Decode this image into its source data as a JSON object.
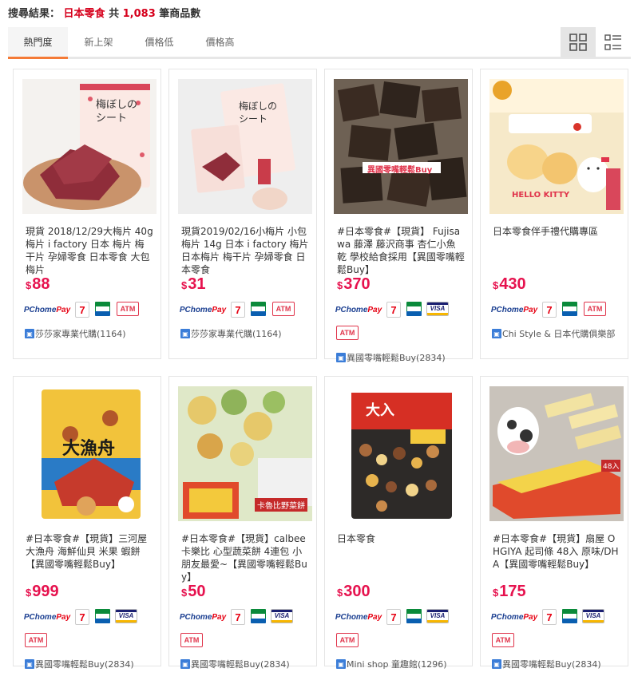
{
  "search": {
    "prefix": "搜尋結果：",
    "keyword": "日本零食",
    "total_prefix": "共",
    "count": "1,083",
    "suffix": "筆商品數"
  },
  "sort_tabs": [
    "熱門度",
    "新上架",
    "價格低",
    "價格高"
  ],
  "active_tab": "熱門度",
  "view_modes": [
    "grid-view-icon",
    "list-view-icon"
  ],
  "colors": {
    "accent": "#f47a36",
    "price": "#e6124e",
    "keyword": "#d6001c"
  },
  "payment_labels": {
    "pchome_pc": "PChome",
    "pchome_pay": "Pay",
    "seven": "7",
    "visa": "VISA",
    "atm": "ATM"
  },
  "products": [
    {
      "title": "現貨 2018/12/29大梅片 40g 梅片 i factory 日本 梅片 梅干片 孕婦零食 日本零食 大包梅片",
      "currency": "$",
      "price": "88",
      "payments": [
        "pchome",
        "seven",
        "family",
        "atm"
      ],
      "seller": "莎莎家專業代購(1164)",
      "image_text": "梅ぼしのシート"
    },
    {
      "title": "現貨2019/02/16小梅片 小包梅片 14g 日本 i factory 梅片 日本梅片 梅干片 孕婦零食 日本零食",
      "currency": "$",
      "price": "31",
      "payments": [
        "pchome",
        "seven",
        "family",
        "atm"
      ],
      "seller": "莎莎家專業代購(1164)",
      "image_text": "梅ぼしのシート"
    },
    {
      "title": "#日本零食#【現貨】 Fujisawa 藤澤 藤沢商事 杏仁小魚乾 學校給食採用【異國零嘴輕鬆Buy】",
      "currency": "$",
      "price": "370",
      "payments": [
        "pchome",
        "seven",
        "family",
        "visa",
        "atm"
      ],
      "seller": "異國零嘴輕鬆Buy(2834)",
      "image_text": "異國零嘴輕鬆Buy"
    },
    {
      "title": "日本零食伴手禮代購專區",
      "currency": "$",
      "price": "430",
      "payments": [
        "pchome",
        "seven",
        "family",
        "atm"
      ],
      "seller": "Chi Style & 日本代購俱樂部",
      "image_text": "HELLO KITTY"
    },
    {
      "title": "#日本零食#【現貨】三河屋 大漁舟 海鮮仙貝 米果 蝦餅【異國零嘴輕鬆Buy】",
      "currency": "$",
      "price": "999",
      "payments": [
        "pchome",
        "seven",
        "family",
        "visa",
        "atm"
      ],
      "seller": "異國零嘴輕鬆Buy(2834)",
      "image_text": "大漁舟"
    },
    {
      "title": "#日本零食#【現貨】calbee卡樂比 心型蔬菜餅 4連包 小朋友最愛~【異國零嘴輕鬆Buy】",
      "currency": "$",
      "price": "50",
      "payments": [
        "pchome",
        "seven",
        "family",
        "visa",
        "atm"
      ],
      "seller": "異國零嘴輕鬆Buy(2834)",
      "image_text": "卡魯比野菜餅"
    },
    {
      "title": "日本零食",
      "currency": "$",
      "price": "300",
      "payments": [
        "pchome",
        "seven",
        "family",
        "visa",
        "atm"
      ],
      "seller": "Mini shop 童趣館(1296)",
      "image_text": "大入"
    },
    {
      "title": "#日本零食#【現貨】扇屋 OHGIYA 起司條 48入 原味/DHA【異國零嘴輕鬆Buy】",
      "currency": "$",
      "price": "175",
      "payments": [
        "pchome",
        "seven",
        "family",
        "visa",
        "atm"
      ],
      "seller": "異國零嘴輕鬆Buy(2834)",
      "image_text": "48入"
    }
  ]
}
